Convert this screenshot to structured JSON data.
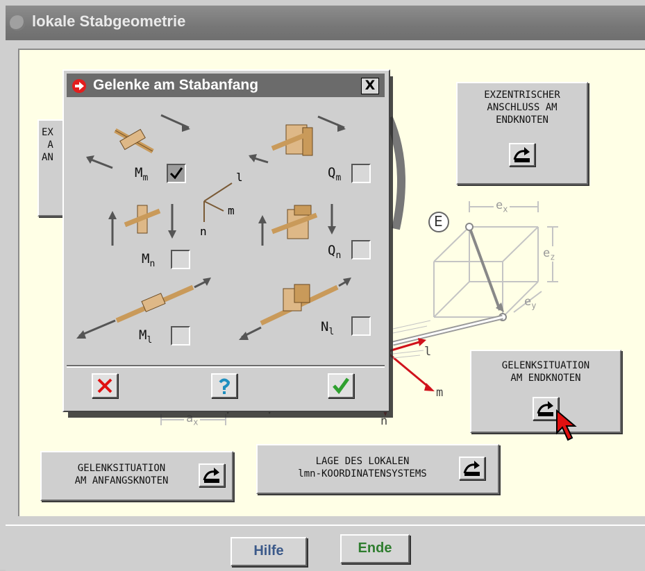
{
  "window": {
    "title": "lokale Stabgeometrie"
  },
  "buttons": {
    "ecc_end": "EXZENTRISCHER\nANSCHLUSS AM\nENDKNOTEN",
    "ecc_start_partial": "EX\n A\nAN",
    "hinge_end": "GELENKSITUATION\nAM ENDKNOTEN",
    "hinge_start": "GELENKSITUATION\nAM ANFANGSKNOTEN",
    "local_cs": "LAGE DES LOKALEN\nlmn-KOORDINATENSYSTEMS"
  },
  "diagram": {
    "node": "E",
    "ex": "e",
    "ex_sub": "x",
    "ey": "e",
    "ey_sub": "y",
    "ez": "e",
    "ez_sub": "z",
    "ax": "a",
    "ax_sub": "x",
    "l": "l",
    "m": "m",
    "n": "n"
  },
  "dialog": {
    "title": "Gelenke am Stabanfang",
    "close": "X",
    "axes": {
      "l": "l",
      "m": "m",
      "n": "n"
    },
    "checkboxes": [
      {
        "id": "Mm",
        "label": "M",
        "sub": "m",
        "checked": true
      },
      {
        "id": "Qm",
        "label": "Q",
        "sub": "m",
        "checked": false
      },
      {
        "id": "Mn",
        "label": "M",
        "sub": "n",
        "checked": false
      },
      {
        "id": "Qn",
        "label": "Q",
        "sub": "n",
        "checked": false
      },
      {
        "id": "Ml",
        "label": "M",
        "sub": "l",
        "checked": false
      },
      {
        "id": "Nl",
        "label": "N",
        "sub": "l",
        "checked": false
      }
    ],
    "cancel_icon": "cancel-icon",
    "help_icon": "help-icon",
    "ok_icon": "ok-icon"
  },
  "footer": {
    "help": "Hilfe",
    "end": "Ende"
  },
  "colors": {
    "yellow_bg": "#ffffe6",
    "title_bg": "#777777",
    "end_green": "#2f7d2f",
    "help_blue": "#3c5a8a"
  }
}
